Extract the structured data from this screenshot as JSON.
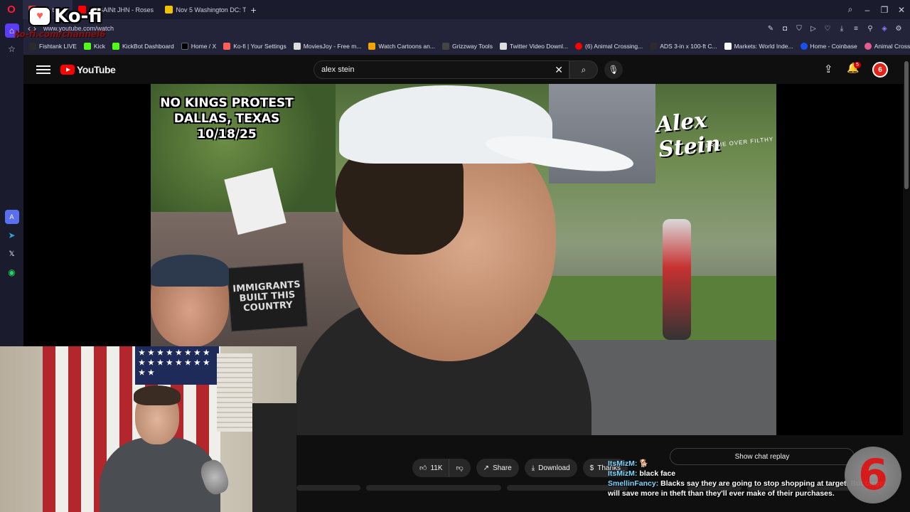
{
  "browser": {
    "logo": "O",
    "tabs": [
      {
        "label": "...at the...",
        "color": "#e0463a",
        "active": true
      },
      {
        "label": "(5) SAINt JHN - Roses",
        "color": "#ff0000",
        "active": false
      },
      {
        "label": "Nov 5 Washington DC: Tr...",
        "color": "#f2c200",
        "active": false
      }
    ],
    "new_tab": "+",
    "url": "www.youtube.com/watch"
  },
  "bookmarks": [
    {
      "label": "Fishtank LIVE",
      "color": "#2b2b2b"
    },
    {
      "label": "Kick",
      "color": "#53fc18"
    },
    {
      "label": "KickBot Dashboard",
      "color": "#53fc18"
    },
    {
      "label": "Home / X",
      "color": "#000000"
    },
    {
      "label": "Ko-fi | Your Settings",
      "color": "#ff5e5b"
    },
    {
      "label": "MoviesJoy - Free m...",
      "color": "#dddddd"
    },
    {
      "label": "Watch Cartoons an...",
      "color": "#f0a500"
    },
    {
      "label": "Grizzway Tools",
      "color": "#444444"
    },
    {
      "label": "Twitter Video Downl...",
      "color": "#dddddd"
    },
    {
      "label": "(6) Animal Crossing...",
      "color": "#ff0000"
    },
    {
      "label": "ADS 3-in x 100-ft C...",
      "color": "#2b2b2b"
    },
    {
      "label": "Markets: World Inde...",
      "color": "#ffffff"
    },
    {
      "label": "Home - Coinbase",
      "color": "#1652f0"
    },
    {
      "label": "Animal Crossing: Ne...",
      "color": "#e35d8e"
    }
  ],
  "youtube": {
    "logo_text": "YouTube",
    "search_value": "alex stein",
    "notification_count": "5",
    "avatar_text": "6"
  },
  "video": {
    "title_lines": [
      "NO KINGS PROTEST",
      "DALLAS, TEXAS",
      "10/18/25"
    ],
    "watermark": "Alex Stein",
    "watermark_sub": "PRIME OVER FILTHY",
    "sign_text": [
      "IMMIGRANTS",
      "BUILT THIS",
      "COUNTRY"
    ]
  },
  "kofi": {
    "word": "Ko-fi",
    "url": "ko-fi.com/channel6"
  },
  "actions": {
    "like_count": "11K",
    "share": "Share",
    "download": "Download",
    "thanks": "Thanks"
  },
  "show_chat_replay": "Show chat replay",
  "chat": [
    {
      "user": "ItsMizM:",
      "text": "🐕"
    },
    {
      "user": "ItsMizM:",
      "text": "black face"
    },
    {
      "user": "SmellinFancy:",
      "text": "Blacks say they are going to stop shopping at target. But target will save more in theft than they'll ever make of their purchases."
    }
  ],
  "channel_logo": "6"
}
